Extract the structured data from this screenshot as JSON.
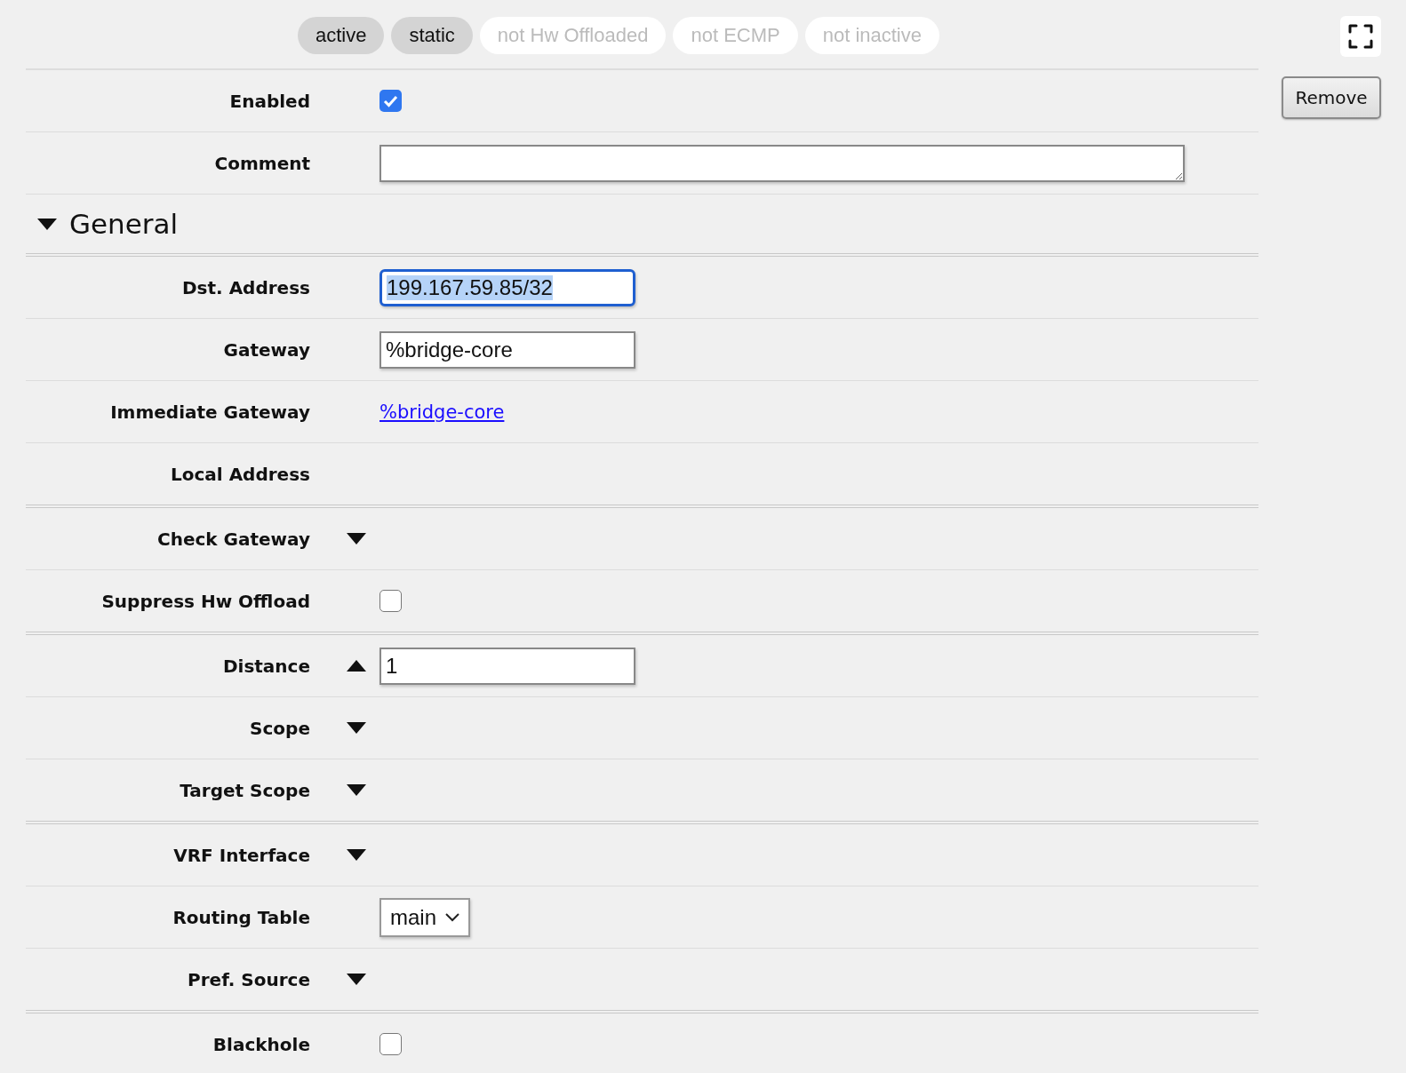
{
  "tags": [
    {
      "label": "active",
      "selected": true
    },
    {
      "label": "static",
      "selected": true
    },
    {
      "label": "not Hw Offloaded",
      "selected": false
    },
    {
      "label": "not ECMP",
      "selected": false
    },
    {
      "label": "not inactive",
      "selected": false
    }
  ],
  "remove_button": "Remove",
  "top_fields": [
    {
      "label": "Enabled",
      "kind": "checkbox",
      "checked": true
    },
    {
      "label": "Comment",
      "kind": "textarea"
    }
  ],
  "sections": [
    {
      "title": "General",
      "expanded": true,
      "groups": [
        [
          {
            "label": "Dst. Address",
            "kind": "input",
            "value": "199.167.59.85/32",
            "focused": true
          },
          {
            "label": "Gateway",
            "kind": "input",
            "value": "%bridge-core",
            "focused": false
          },
          {
            "label": "Immediate Gateway",
            "kind": "link",
            "value": "%bridge-core"
          },
          {
            "label": "Local Address",
            "kind": "plain"
          }
        ],
        [
          {
            "label": "Check Gateway",
            "kind": "toggle",
            "expanded": false
          },
          {
            "label": "Suppress Hw Offload",
            "kind": "checkbox",
            "checked": false
          }
        ],
        [
          {
            "label": "Distance",
            "kind": "toggle",
            "expanded": true,
            "value": "1"
          },
          {
            "label": "Scope",
            "kind": "toggle",
            "expanded": false
          },
          {
            "label": "Target Scope",
            "kind": "toggle",
            "expanded": false
          }
        ],
        [
          {
            "label": "VRF Interface",
            "kind": "toggle",
            "expanded": false
          },
          {
            "label": "Routing Table",
            "kind": "select",
            "value": "main"
          },
          {
            "label": "Pref. Source",
            "kind": "toggle",
            "expanded": false
          }
        ],
        [
          {
            "label": "Blackhole",
            "kind": "checkbox",
            "checked": false
          }
        ]
      ]
    }
  ]
}
